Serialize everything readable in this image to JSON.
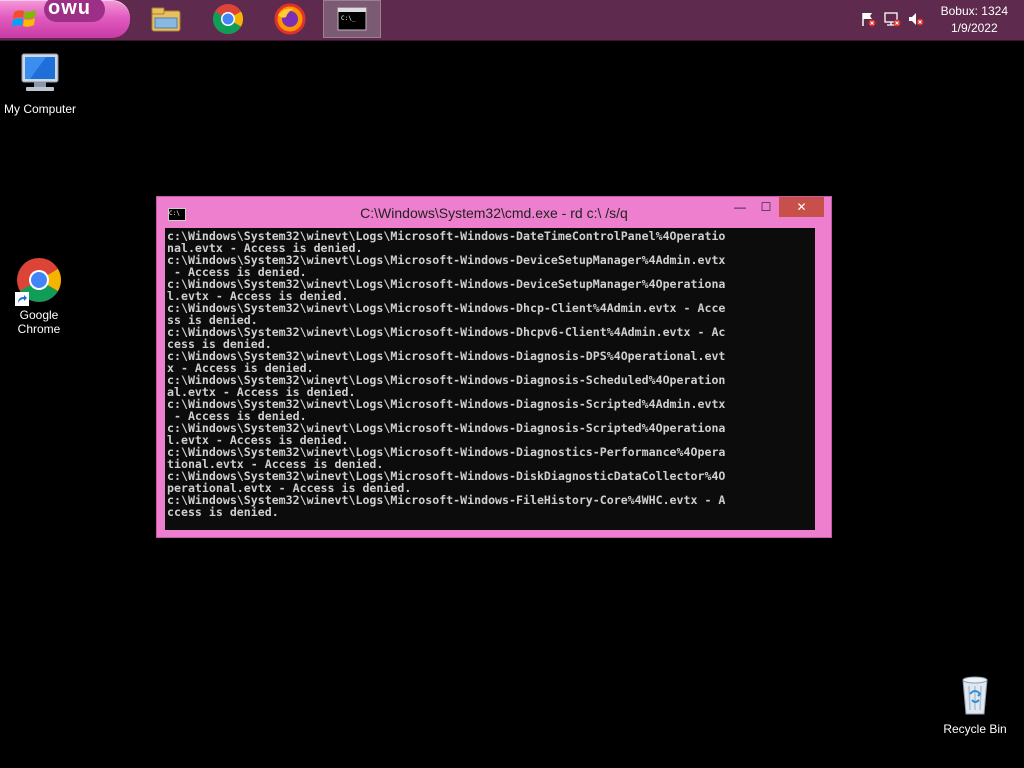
{
  "taskbar": {
    "start_label": "owu",
    "apps": [
      {
        "name": "file-explorer-icon"
      },
      {
        "name": "chrome-icon"
      },
      {
        "name": "firefox-icon"
      },
      {
        "name": "cmd-icon"
      }
    ],
    "user_label": "Bobux: 1324",
    "date": "1/9/2022"
  },
  "desktop": {
    "icons": {
      "my_computer": "My Computer",
      "chrome_line1": "Google",
      "chrome_line2": "Chrome",
      "recycle_bin": "Recycle Bin"
    }
  },
  "window": {
    "title": "C:\\Windows\\System32\\cmd.exe - rd  c:\\ /s/q",
    "minimize_glyph": "—",
    "maximize_glyph": "☐",
    "close_glyph": "✕",
    "console_lines": [
      "c:\\Windows\\System32\\winevt\\Logs\\Microsoft-Windows-DateTimeControlPanel%4Operatio",
      "nal.evtx - Access is denied.",
      "c:\\Windows\\System32\\winevt\\Logs\\Microsoft-Windows-DeviceSetupManager%4Admin.evtx",
      " - Access is denied.",
      "c:\\Windows\\System32\\winevt\\Logs\\Microsoft-Windows-DeviceSetupManager%4Operationa",
      "l.evtx - Access is denied.",
      "c:\\Windows\\System32\\winevt\\Logs\\Microsoft-Windows-Dhcp-Client%4Admin.evtx - Acce",
      "ss is denied.",
      "c:\\Windows\\System32\\winevt\\Logs\\Microsoft-Windows-Dhcpv6-Client%4Admin.evtx - Ac",
      "cess is denied.",
      "c:\\Windows\\System32\\winevt\\Logs\\Microsoft-Windows-Diagnosis-DPS%4Operational.evt",
      "x - Access is denied.",
      "c:\\Windows\\System32\\winevt\\Logs\\Microsoft-Windows-Diagnosis-Scheduled%4Operation",
      "al.evtx - Access is denied.",
      "c:\\Windows\\System32\\winevt\\Logs\\Microsoft-Windows-Diagnosis-Scripted%4Admin.evtx",
      " - Access is denied.",
      "c:\\Windows\\System32\\winevt\\Logs\\Microsoft-Windows-Diagnosis-Scripted%4Operationa",
      "l.evtx - Access is denied.",
      "c:\\Windows\\System32\\winevt\\Logs\\Microsoft-Windows-Diagnostics-Performance%4Opera",
      "tional.evtx - Access is denied.",
      "c:\\Windows\\System32\\winevt\\Logs\\Microsoft-Windows-DiskDiagnosticDataCollector%4O",
      "perational.evtx - Access is denied.",
      "c:\\Windows\\System32\\winevt\\Logs\\Microsoft-Windows-FileHistory-Core%4WHC.evtx - A",
      "ccess is denied."
    ]
  },
  "colors": {
    "taskbar": "#5e2a4e",
    "window_frame": "#ee7fcf",
    "close_button": "#c7504a",
    "console_bg": "#0c0c0c",
    "console_text": "#cfcfcf"
  }
}
